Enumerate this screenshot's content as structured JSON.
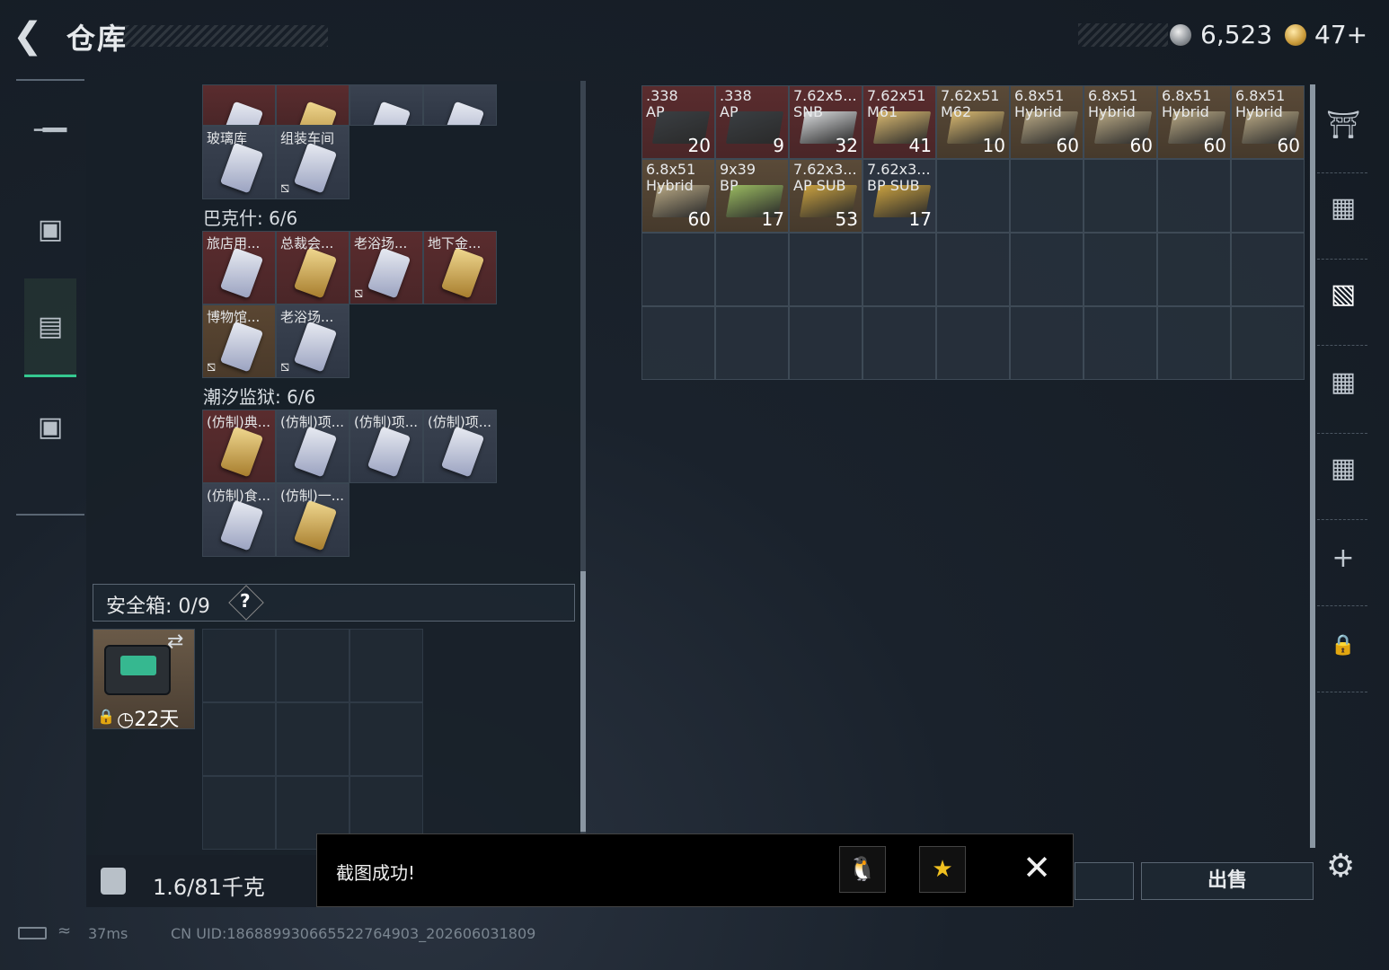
{
  "header": {
    "title": "仓库",
    "currency_silver": "6,523",
    "currency_gold": "47+",
    "small_note": "!!!! !!!!"
  },
  "left_panel": {
    "top_partial_row": [
      {
        "label": "",
        "style": "red",
        "card": "dark"
      },
      {
        "label": "",
        "style": "red",
        "card": "gold"
      },
      {
        "label": "",
        "style": "gray",
        "card": "dark"
      },
      {
        "label": "",
        "style": "gray",
        "card": "dark"
      }
    ],
    "group1_row": [
      {
        "label": "玻璃库",
        "style": "gray",
        "card": "dark",
        "nobind": false
      },
      {
        "label": "组装车间",
        "style": "gray",
        "card": "dark",
        "nobind": true
      }
    ],
    "section_bakeshi": "巴克什: 6/6",
    "bakeshi_row1": [
      {
        "label": "旅店用...",
        "style": "red",
        "card": "dark",
        "nobind": false
      },
      {
        "label": "总裁会...",
        "style": "red",
        "card": "gold",
        "nobind": false
      },
      {
        "label": "老浴场...",
        "style": "red",
        "card": "dark",
        "nobind": true
      },
      {
        "label": "地下金...",
        "style": "red",
        "card": "gold",
        "nobind": false
      }
    ],
    "bakeshi_row2": [
      {
        "label": "博物馆...",
        "style": "brown",
        "card": "dark",
        "nobind": true
      },
      {
        "label": "老浴场...",
        "style": "gray",
        "card": "dark",
        "nobind": true
      }
    ],
    "section_chaoxi": "潮汐监狱: 6/6",
    "chaoxi_row1": [
      {
        "label": "(仿制)典...",
        "style": "red",
        "card": "gold"
      },
      {
        "label": "(仿制)项...",
        "style": "gray",
        "card": "dark"
      },
      {
        "label": "(仿制)项...",
        "style": "gray",
        "card": "dark"
      },
      {
        "label": "(仿制)项...",
        "style": "gray",
        "card": "dark"
      }
    ],
    "chaoxi_row2": [
      {
        "label": "(仿制)食...",
        "style": "gray",
        "card": "dark"
      },
      {
        "label": "(仿制)一...",
        "style": "gray",
        "card": "gold"
      }
    ],
    "safe_box": {
      "label": "安全箱: 0/9",
      "help": "?",
      "time": "22天"
    },
    "weight": "1.6/81千克"
  },
  "right_grid": {
    "items": [
      {
        "name": ".338\nAP",
        "qty": "20",
        "style": "red",
        "box": "#3a3e42"
      },
      {
        "name": ".338\nAP",
        "qty": "9",
        "style": "red",
        "box": "#3a3e42"
      },
      {
        "name": "7.62x5...\nSNB",
        "qty": "32",
        "style": "red",
        "box": "#d8dadc"
      },
      {
        "name": "7.62x51\nM61",
        "qty": "41",
        "style": "red",
        "box": "#d8b870"
      },
      {
        "name": "7.62x51\nM62",
        "qty": "10",
        "style": "brown",
        "box": "#d8b870"
      },
      {
        "name": "6.8x51\nHybrid",
        "qty": "60",
        "style": "brown",
        "box": "#b8a884"
      },
      {
        "name": "6.8x51\nHybrid",
        "qty": "60",
        "style": "brown",
        "box": "#b8a884"
      },
      {
        "name": "6.8x51\nHybrid",
        "qty": "60",
        "style": "brown",
        "box": "#b8a884"
      },
      {
        "name": "6.8x51\nHybrid",
        "qty": "60",
        "style": "brown",
        "box": "#b8a884"
      },
      {
        "name": "6.8x51\nHybrid",
        "qty": "60",
        "style": "brown",
        "box": "#b8a884"
      },
      {
        "name": "9x39\nBP",
        "qty": "17",
        "style": "brown",
        "box": "#98b860"
      },
      {
        "name": "7.62x3...\nAP SUB",
        "qty": "53",
        "style": "brown",
        "box": "#c8a040"
      },
      {
        "name": "7.62x3...\nBP SUB",
        "qty": "17",
        "style": "gray",
        "box": "#c8a040"
      }
    ]
  },
  "buttons": {
    "sell": "出售"
  },
  "toast": {
    "text": "截图成功!"
  },
  "status": {
    "ping": "37ms",
    "uid": "CN UID:186889930665522764903_202606031809"
  }
}
